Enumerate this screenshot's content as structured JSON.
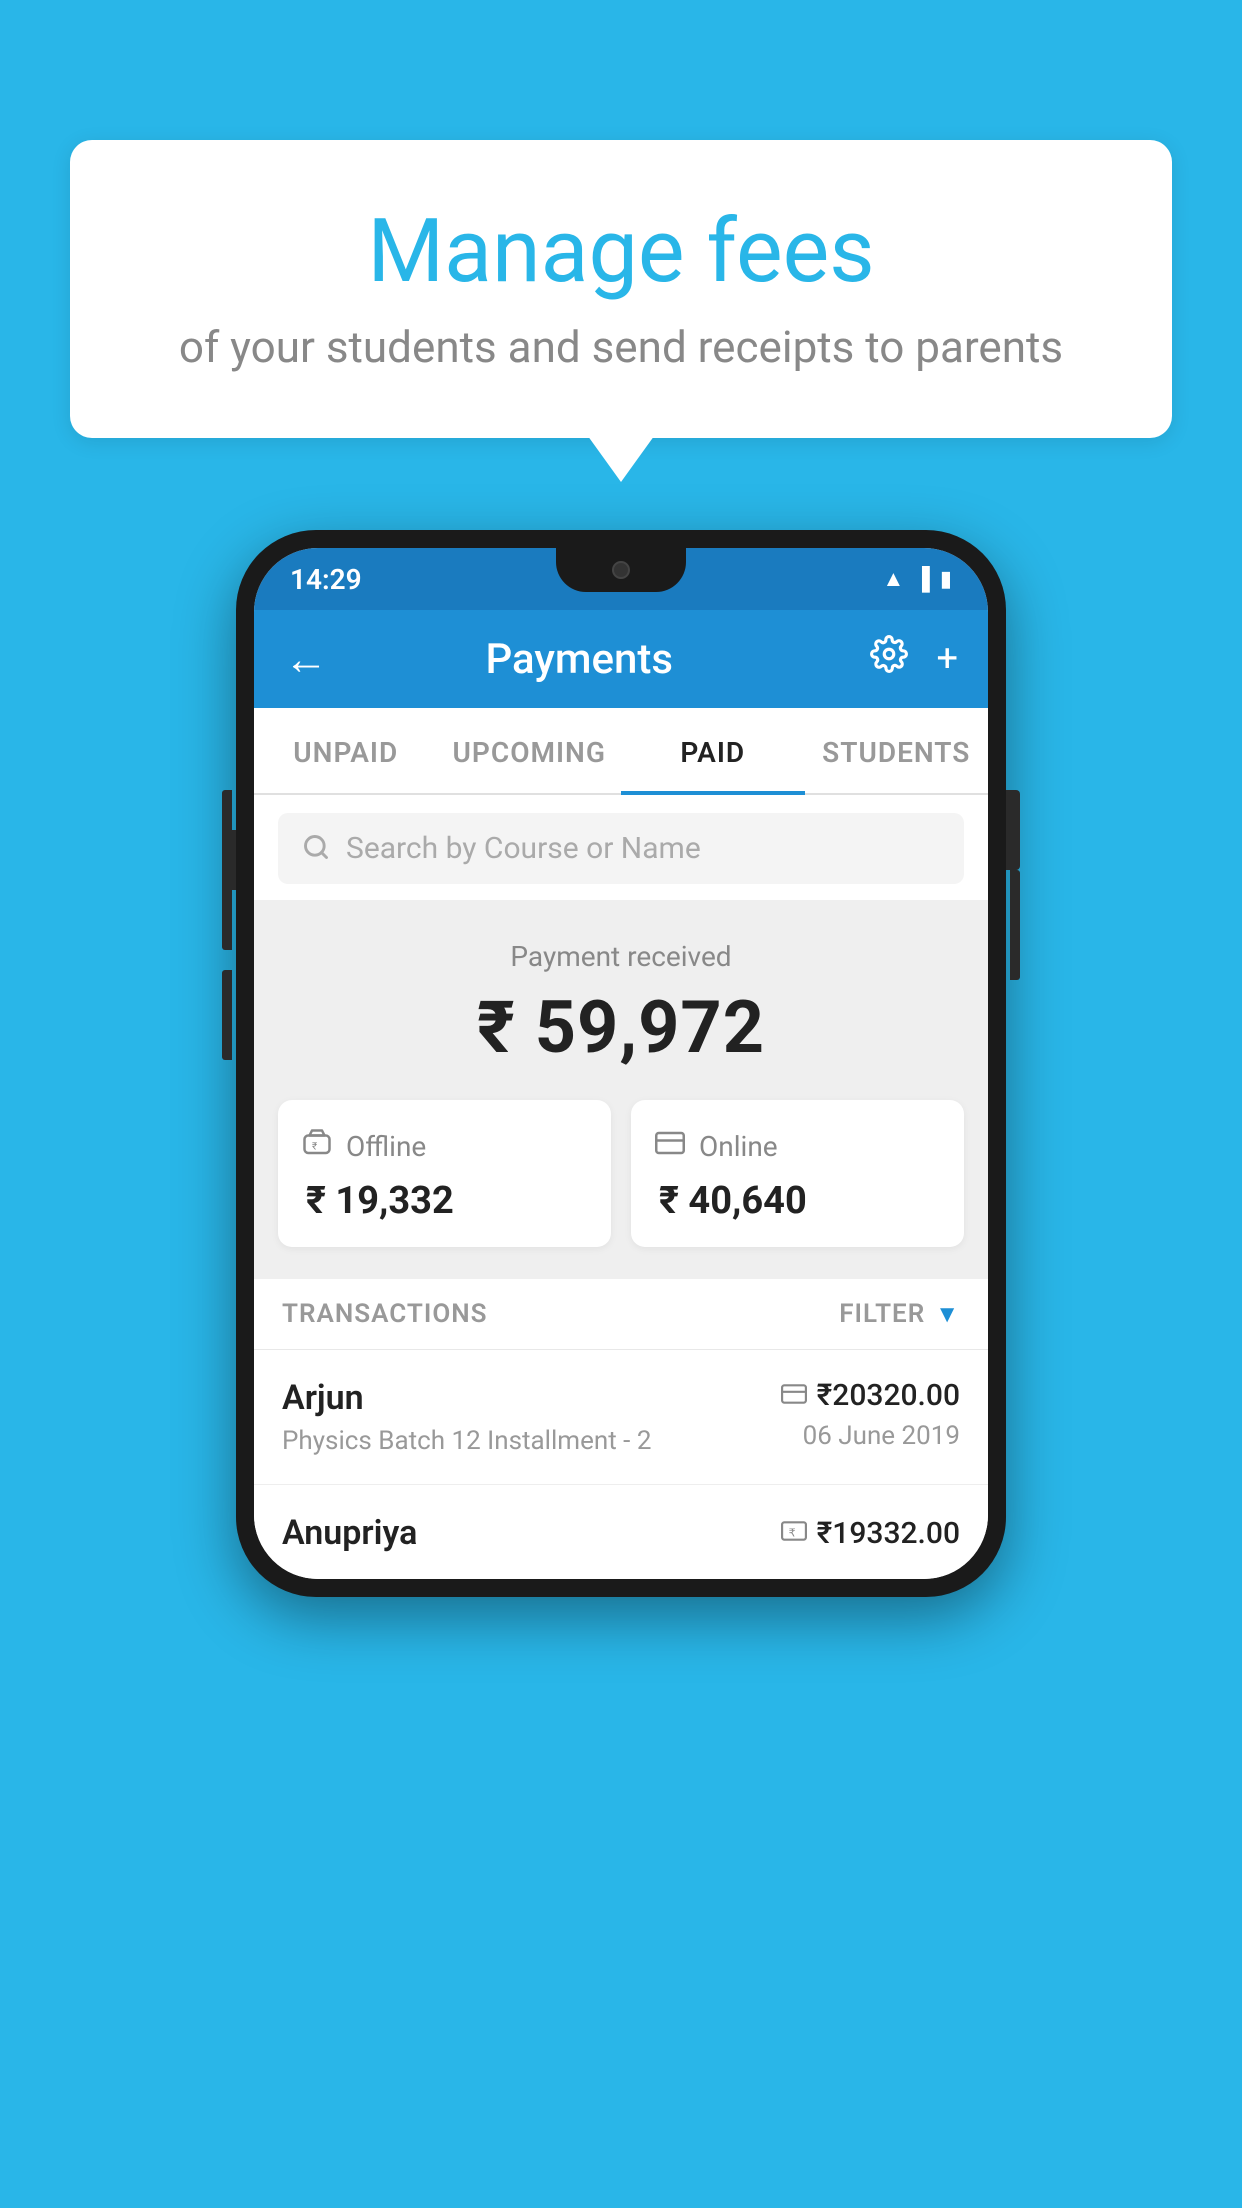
{
  "background_color": "#29b6e8",
  "speech_bubble": {
    "title": "Manage fees",
    "subtitle": "of your students and send receipts to parents"
  },
  "status_bar": {
    "time": "14:29",
    "icons": [
      "wifi",
      "signal",
      "battery"
    ]
  },
  "app_header": {
    "title": "Payments",
    "back_label": "←",
    "settings_label": "⚙",
    "plus_label": "+"
  },
  "tabs": [
    {
      "id": "unpaid",
      "label": "UNPAID",
      "active": false
    },
    {
      "id": "upcoming",
      "label": "UPCOMING",
      "active": false
    },
    {
      "id": "paid",
      "label": "PAID",
      "active": true
    },
    {
      "id": "students",
      "label": "STUDENTS",
      "active": false
    }
  ],
  "search": {
    "placeholder": "Search by Course or Name"
  },
  "payment_summary": {
    "label": "Payment received",
    "amount": "₹ 59,972",
    "offline": {
      "label": "Offline",
      "amount": "₹ 19,332"
    },
    "online": {
      "label": "Online",
      "amount": "₹ 40,640"
    }
  },
  "transactions": {
    "header_label": "TRANSACTIONS",
    "filter_label": "FILTER",
    "rows": [
      {
        "name": "Arjun",
        "detail": "Physics Batch 12 Installment - 2",
        "payment_type": "card",
        "amount": "₹20320.00",
        "date": "06 June 2019"
      },
      {
        "name": "Anupriya",
        "detail": "",
        "payment_type": "rupee",
        "amount": "₹19332.00",
        "date": ""
      }
    ]
  }
}
